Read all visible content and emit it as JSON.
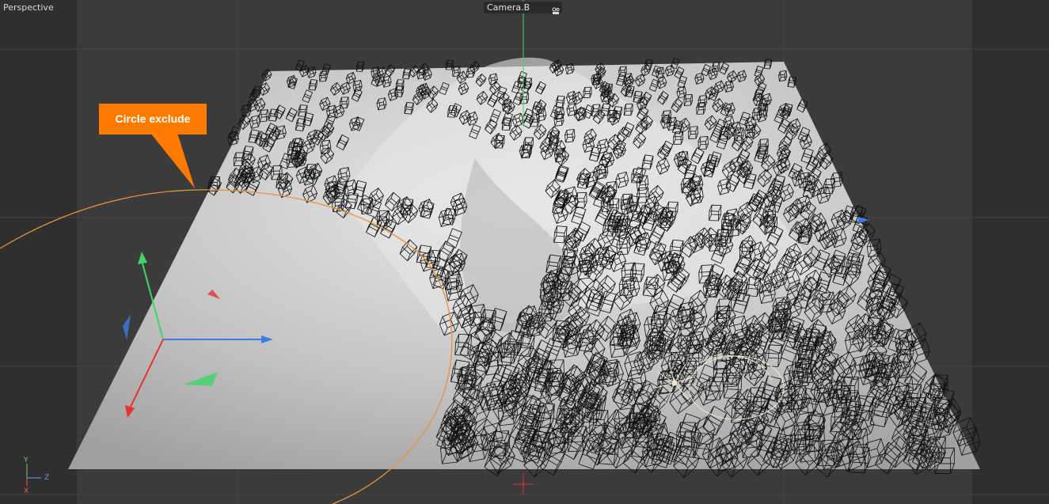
{
  "viewport": {
    "name": "Perspective",
    "camera": "Camera.B"
  },
  "annotation": {
    "text": "Circle exclude",
    "color": "#ff7b00"
  },
  "axis_gizmo": {
    "y": "Y",
    "z": "Z",
    "x": "X"
  },
  "colors": {
    "background": "#3a3a3a",
    "terrain": "#b5b5b5",
    "spline": "#e8913a",
    "axis_x": "#e53232",
    "axis_y": "#3ed66a",
    "axis_z": "#3a7de8"
  }
}
